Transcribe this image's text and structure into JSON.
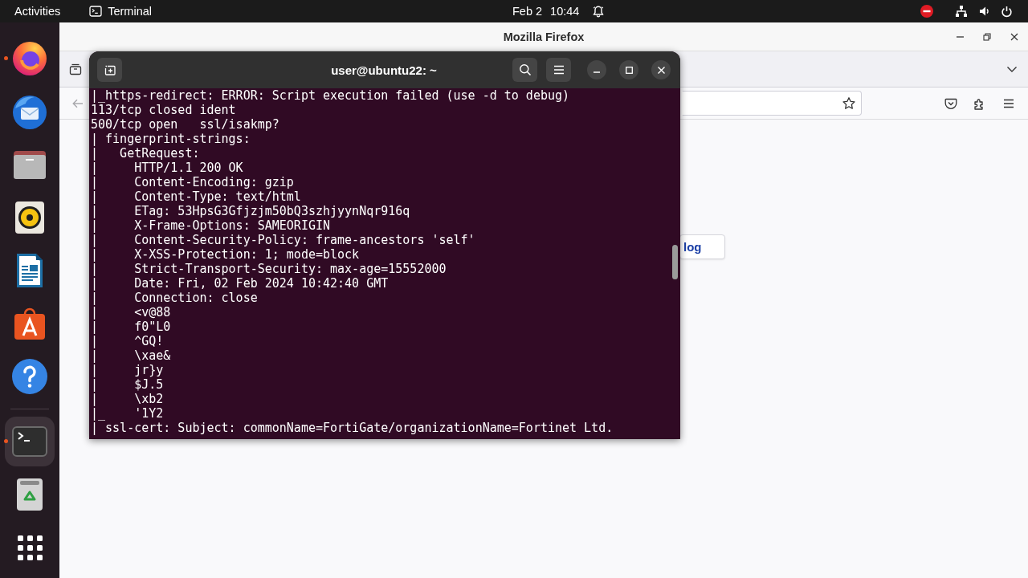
{
  "top_bar": {
    "activities": "Activities",
    "app_menu": "Terminal",
    "date": "Feb 2",
    "time": "10:44"
  },
  "dock": {
    "favorites": [
      {
        "kind": "browser",
        "running": true,
        "selected": false
      },
      {
        "kind": "mail",
        "running": false,
        "selected": false
      },
      {
        "kind": "files",
        "running": false,
        "selected": false
      },
      {
        "kind": "music",
        "running": false,
        "selected": false
      },
      {
        "kind": "writer",
        "running": false,
        "selected": false
      },
      {
        "kind": "store",
        "running": false,
        "selected": false
      },
      {
        "kind": "help",
        "running": false,
        "selected": false
      }
    ],
    "others": [
      {
        "kind": "terminal",
        "running": true,
        "selected": true
      },
      {
        "kind": "trash",
        "running": false,
        "selected": false
      }
    ]
  },
  "browser_window": {
    "title": "Mozilla Firefox",
    "page_button": "log"
  },
  "terminal": {
    "title": "user@ubuntu22: ~",
    "lines": [
      "|_https-redirect: ERROR: Script execution failed (use -d to debug)",
      "113/tcp closed ident",
      "500/tcp open   ssl/isakmp?",
      "| fingerprint-strings:",
      "|   GetRequest:",
      "|     HTTP/1.1 200 OK",
      "|     Content-Encoding: gzip",
      "|     Content-Type: text/html",
      "|     ETag: 53HpsG3Gfjzjm50bQ3szhjyynNqr916q",
      "|     X-Frame-Options: SAMEORIGIN",
      "|     Content-Security-Policy: frame-ancestors 'self'",
      "|     X-XSS-Protection: 1; mode=block",
      "|     Strict-Transport-Security: max-age=15552000",
      "|     Date: Fri, 02 Feb 2024 10:42:40 GMT",
      "|     Connection: close",
      "|     <v@88",
      "|     f0\"L0",
      "|     ^GQ!",
      "|     \\xae&",
      "|     jr}y",
      "|     $J.5",
      "|     \\xb2",
      "|_    '1Y2",
      "| ssl-cert: Subject: commonName=FortiGate/organizationName=Fortinet Ltd."
    ]
  }
}
